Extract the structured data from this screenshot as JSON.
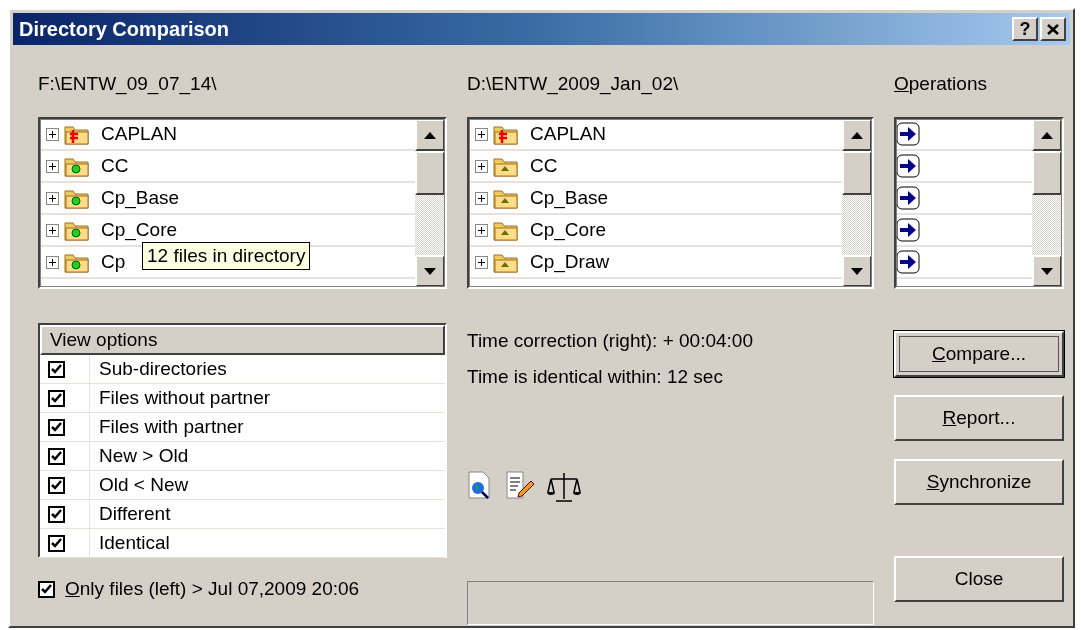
{
  "window": {
    "title": "Directory Comparison",
    "help_button": "?"
  },
  "left": {
    "path": "F:\\ENTW_09_07_14\\",
    "items": [
      {
        "name": "CAPLAN",
        "kind": "different"
      },
      {
        "name": "CC",
        "kind": "newer"
      },
      {
        "name": "Cp_Base",
        "kind": "newer"
      },
      {
        "name": "Cp_Core",
        "kind": "newer"
      },
      {
        "name": "Cp",
        "kind": "newer"
      }
    ],
    "tooltip": "12 files in directory"
  },
  "right": {
    "path": "D:\\ENTW_2009_Jan_02\\",
    "items": [
      {
        "name": "CAPLAN",
        "kind": "different"
      },
      {
        "name": "CC",
        "kind": "older"
      },
      {
        "name": "Cp_Base",
        "kind": "older"
      },
      {
        "name": "Cp_Core",
        "kind": "older"
      },
      {
        "name": "Cp_Draw",
        "kind": "older"
      }
    ]
  },
  "operations": {
    "label": "Operations",
    "items": [
      {
        "kind": "copy-right"
      },
      {
        "kind": "copy-right"
      },
      {
        "kind": "copy-right"
      },
      {
        "kind": "copy-right"
      },
      {
        "kind": "copy-right"
      }
    ]
  },
  "view_options": {
    "header": "View options",
    "items": [
      {
        "label": "Sub-directories",
        "checked": true
      },
      {
        "label": "Files without partner",
        "checked": true
      },
      {
        "label": "Files with partner",
        "checked": true
      },
      {
        "label": "New > Old",
        "checked": true
      },
      {
        "label": "Old < New",
        "checked": true
      },
      {
        "label": "Different",
        "checked": true
      },
      {
        "label": "Identical",
        "checked": true
      }
    ]
  },
  "only_files": {
    "label": "Only files (left) > Jul 07,2009 20:06",
    "checked": true
  },
  "info": [
    "Time correction (right): + 00:04:00",
    "Time is identical within: 12 sec"
  ],
  "buttons": [
    {
      "label": "Compare...",
      "default": true
    },
    {
      "label": "Report...",
      "default": false
    },
    {
      "label": "Synchronize",
      "default": false
    },
    {
      "label": "Close",
      "default": false
    }
  ]
}
